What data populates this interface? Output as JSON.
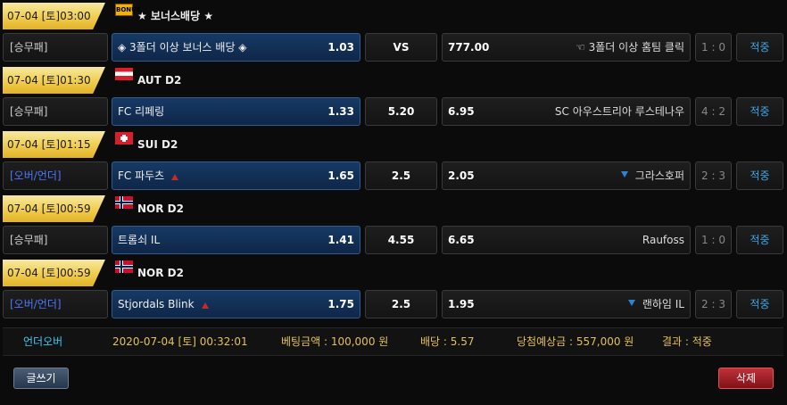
{
  "groups": [
    {
      "time": "07-04 [토]03:00",
      "flag": "bonus",
      "flag_text": "BONUS",
      "league": "★ 보너스배당 ★",
      "bet": {
        "type": "[승무패]",
        "type_ou": false,
        "home": "◈ 3폴더 이상 보너스 배당 ◈",
        "home_odds": "1.03",
        "mid": "VS",
        "away_odds": "777.00",
        "away": "☜ 3폴더 이상 홈팀 클릭",
        "score": "1 : 0",
        "result": "적중",
        "home_icon": "",
        "away_icon": ""
      }
    },
    {
      "time": "07-04 [토]01:30",
      "flag": "aut",
      "league": "AUT D2",
      "bet": {
        "type": "[승무패]",
        "type_ou": false,
        "home": "FC 리페링",
        "home_odds": "1.33",
        "mid": "5.20",
        "away_odds": "6.95",
        "away": "SC 아우스트리아 루스테나우",
        "score": "4 : 2",
        "result": "적중",
        "home_icon": "",
        "away_icon": ""
      }
    },
    {
      "time": "07-04 [토]01:15",
      "flag": "sui",
      "league": "SUI D2",
      "bet": {
        "type": "[오버/언더]",
        "type_ou": true,
        "home": "FC 파두츠",
        "home_odds": "1.65",
        "mid": "2.5",
        "away_odds": "2.05",
        "away": "그라스호퍼",
        "score": "2 : 3",
        "result": "적중",
        "home_icon": "up-arrow-icon",
        "away_icon": "down-arrow-icon"
      }
    },
    {
      "time": "07-04 [토]00:59",
      "flag": "nor",
      "league": "NOR D2",
      "bet": {
        "type": "[승무패]",
        "type_ou": false,
        "home": "트롬쇠 IL",
        "home_odds": "1.41",
        "mid": "4.55",
        "away_odds": "6.65",
        "away": "Raufoss",
        "score": "1 : 0",
        "result": "적중",
        "home_icon": "",
        "away_icon": ""
      }
    },
    {
      "time": "07-04 [토]00:59",
      "flag": "nor",
      "league": "NOR D2",
      "bet": {
        "type": "[오버/언더]",
        "type_ou": true,
        "home": "Stjordals Blink",
        "home_odds": "1.75",
        "mid": "2.5",
        "away_odds": "1.95",
        "away": "랜하임 IL",
        "score": "2 : 3",
        "result": "적중",
        "home_icon": "up-arrow-icon",
        "away_icon": "down-arrow-icon"
      }
    }
  ],
  "summary": {
    "category": "언더오버",
    "datetime": "2020-07-04 [토] 00:32:01",
    "bet_amount": "베팅금액 : 100,000 원",
    "odds": "배당 : 5.57",
    "expected_win": "당첨예상금 : 557,000 원",
    "result": "결과 : 적중"
  },
  "footer": {
    "write_label": "글쓰기",
    "delete_label": "삭제"
  }
}
